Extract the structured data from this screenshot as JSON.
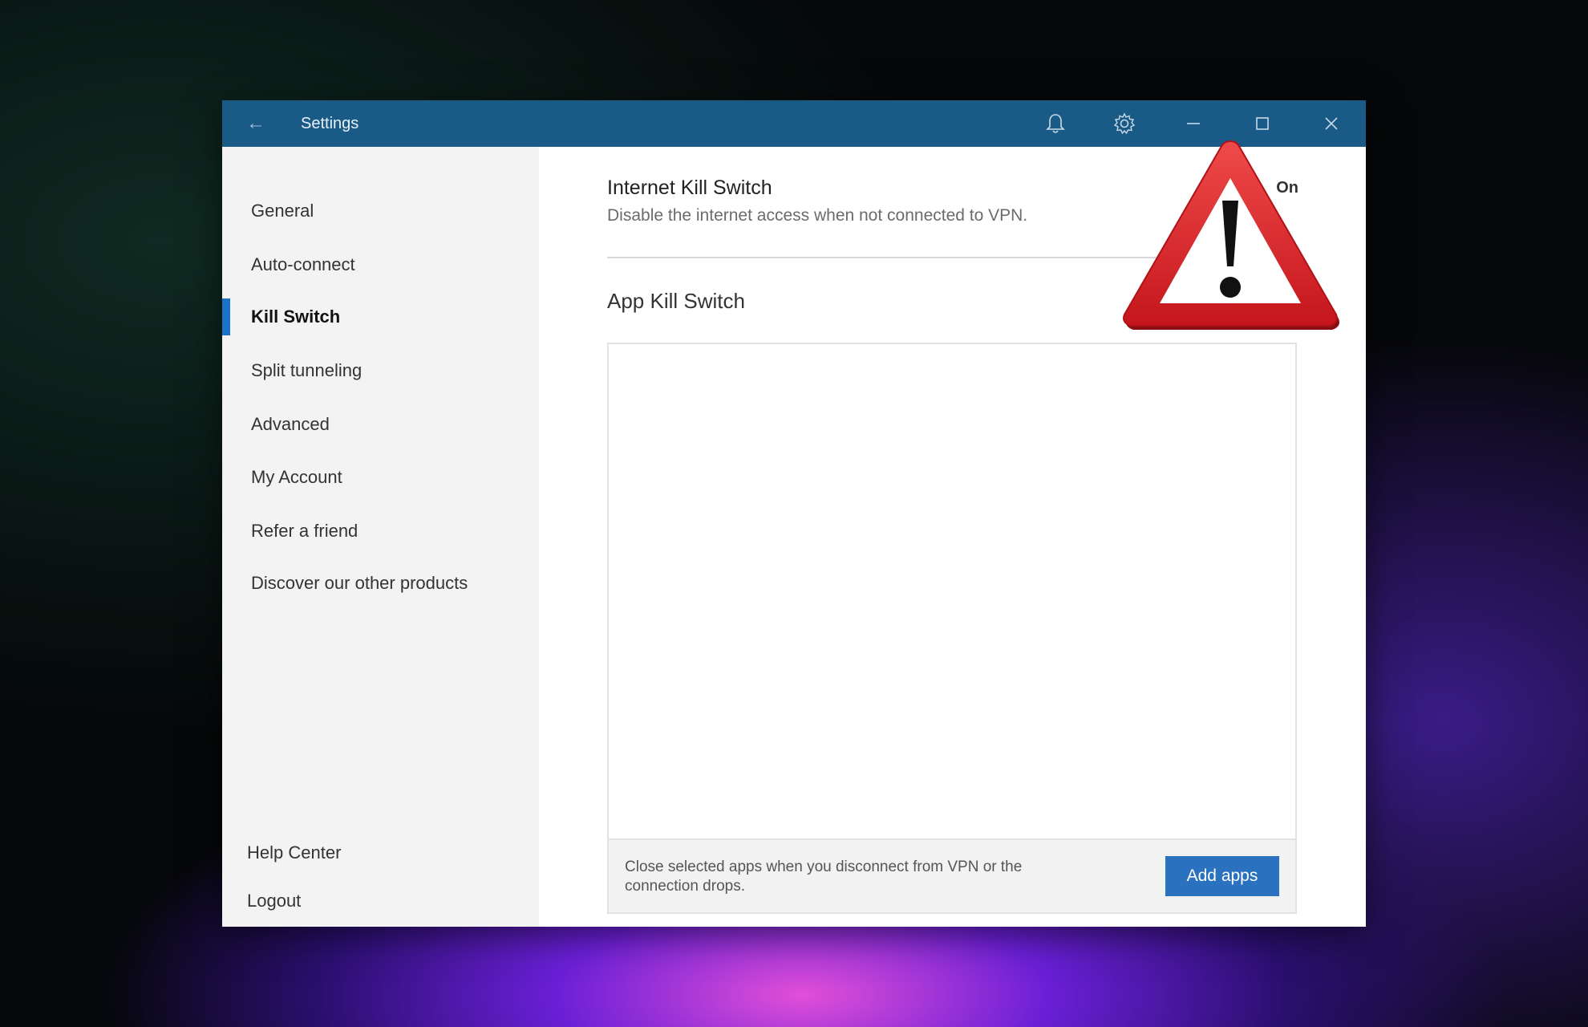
{
  "window": {
    "title": "Settings"
  },
  "titlebar": {
    "back_icon": "arrow-left-icon",
    "actions": [
      "bell-icon",
      "gear-icon",
      "minimize-icon",
      "maximize-icon",
      "close-icon"
    ]
  },
  "sidebar": {
    "items": [
      {
        "label": "General"
      },
      {
        "label": "Auto-connect"
      },
      {
        "label": "Kill Switch",
        "active": true
      },
      {
        "label": "Split tunneling"
      },
      {
        "label": "Advanced"
      },
      {
        "label": "My Account"
      },
      {
        "label": "Refer a friend"
      },
      {
        "label": "Discover our other products"
      }
    ],
    "bottom": [
      {
        "label": "Help Center"
      },
      {
        "label": "Logout"
      }
    ]
  },
  "main": {
    "internet_kill_switch": {
      "title": "Internet Kill Switch",
      "description": "Disable the internet access when not connected to VPN.",
      "state": "On"
    },
    "app_kill_switch": {
      "title": "App Kill Switch",
      "footer_text": "Close selected apps when you disconnect from VPN or the connection drops.",
      "add_button": "Add apps"
    }
  },
  "overlay": {
    "icon": "warning-triangle-icon",
    "color": "#e0252b"
  },
  "colors": {
    "titlebar": "#1a5a87",
    "accent": "#1a73c9",
    "button": "#2a72c0"
  }
}
